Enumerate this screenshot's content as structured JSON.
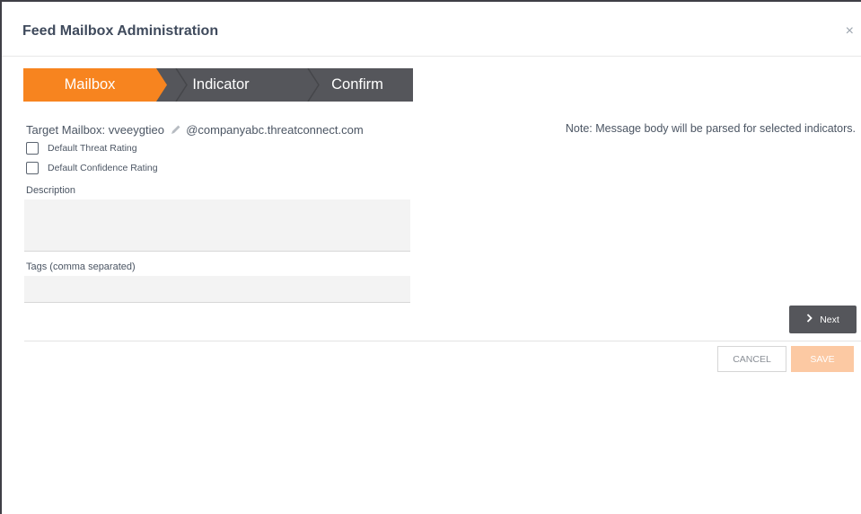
{
  "dialog": {
    "title": "Feed Mailbox Administration",
    "close_symbol": "×"
  },
  "wizard": {
    "steps": [
      {
        "label": "Mailbox",
        "active": true
      },
      {
        "label": "Indicator",
        "active": false
      },
      {
        "label": "Confirm",
        "active": false
      }
    ],
    "active_color": "#f7841f",
    "inactive_color": "#55565b"
  },
  "mailbox": {
    "target_label": "Target Mailbox:",
    "mailbox_name": "vveeygtieo",
    "domain": "@companyabc.threatconnect.com",
    "edit_icon": "pencil-icon"
  },
  "options": {
    "default_threat_rating": {
      "label": "Default Threat Rating",
      "checked": false
    },
    "default_confidence_rating": {
      "label": "Default Confidence Rating",
      "checked": false
    }
  },
  "fields": {
    "description_label": "Description",
    "description_value": "",
    "tags_label": "Tags (comma separated)",
    "tags_value": ""
  },
  "note": "Note: Message body will be parsed for selected indicators.",
  "buttons": {
    "next_label": "Next",
    "next_icon": "chevron-right-icon",
    "cancel_label": "CANCEL",
    "save_label": "SAVE"
  },
  "colors": {
    "accent": "#f7841f",
    "save_disabled": "#fcc9a3",
    "dark_button": "#55565b"
  }
}
